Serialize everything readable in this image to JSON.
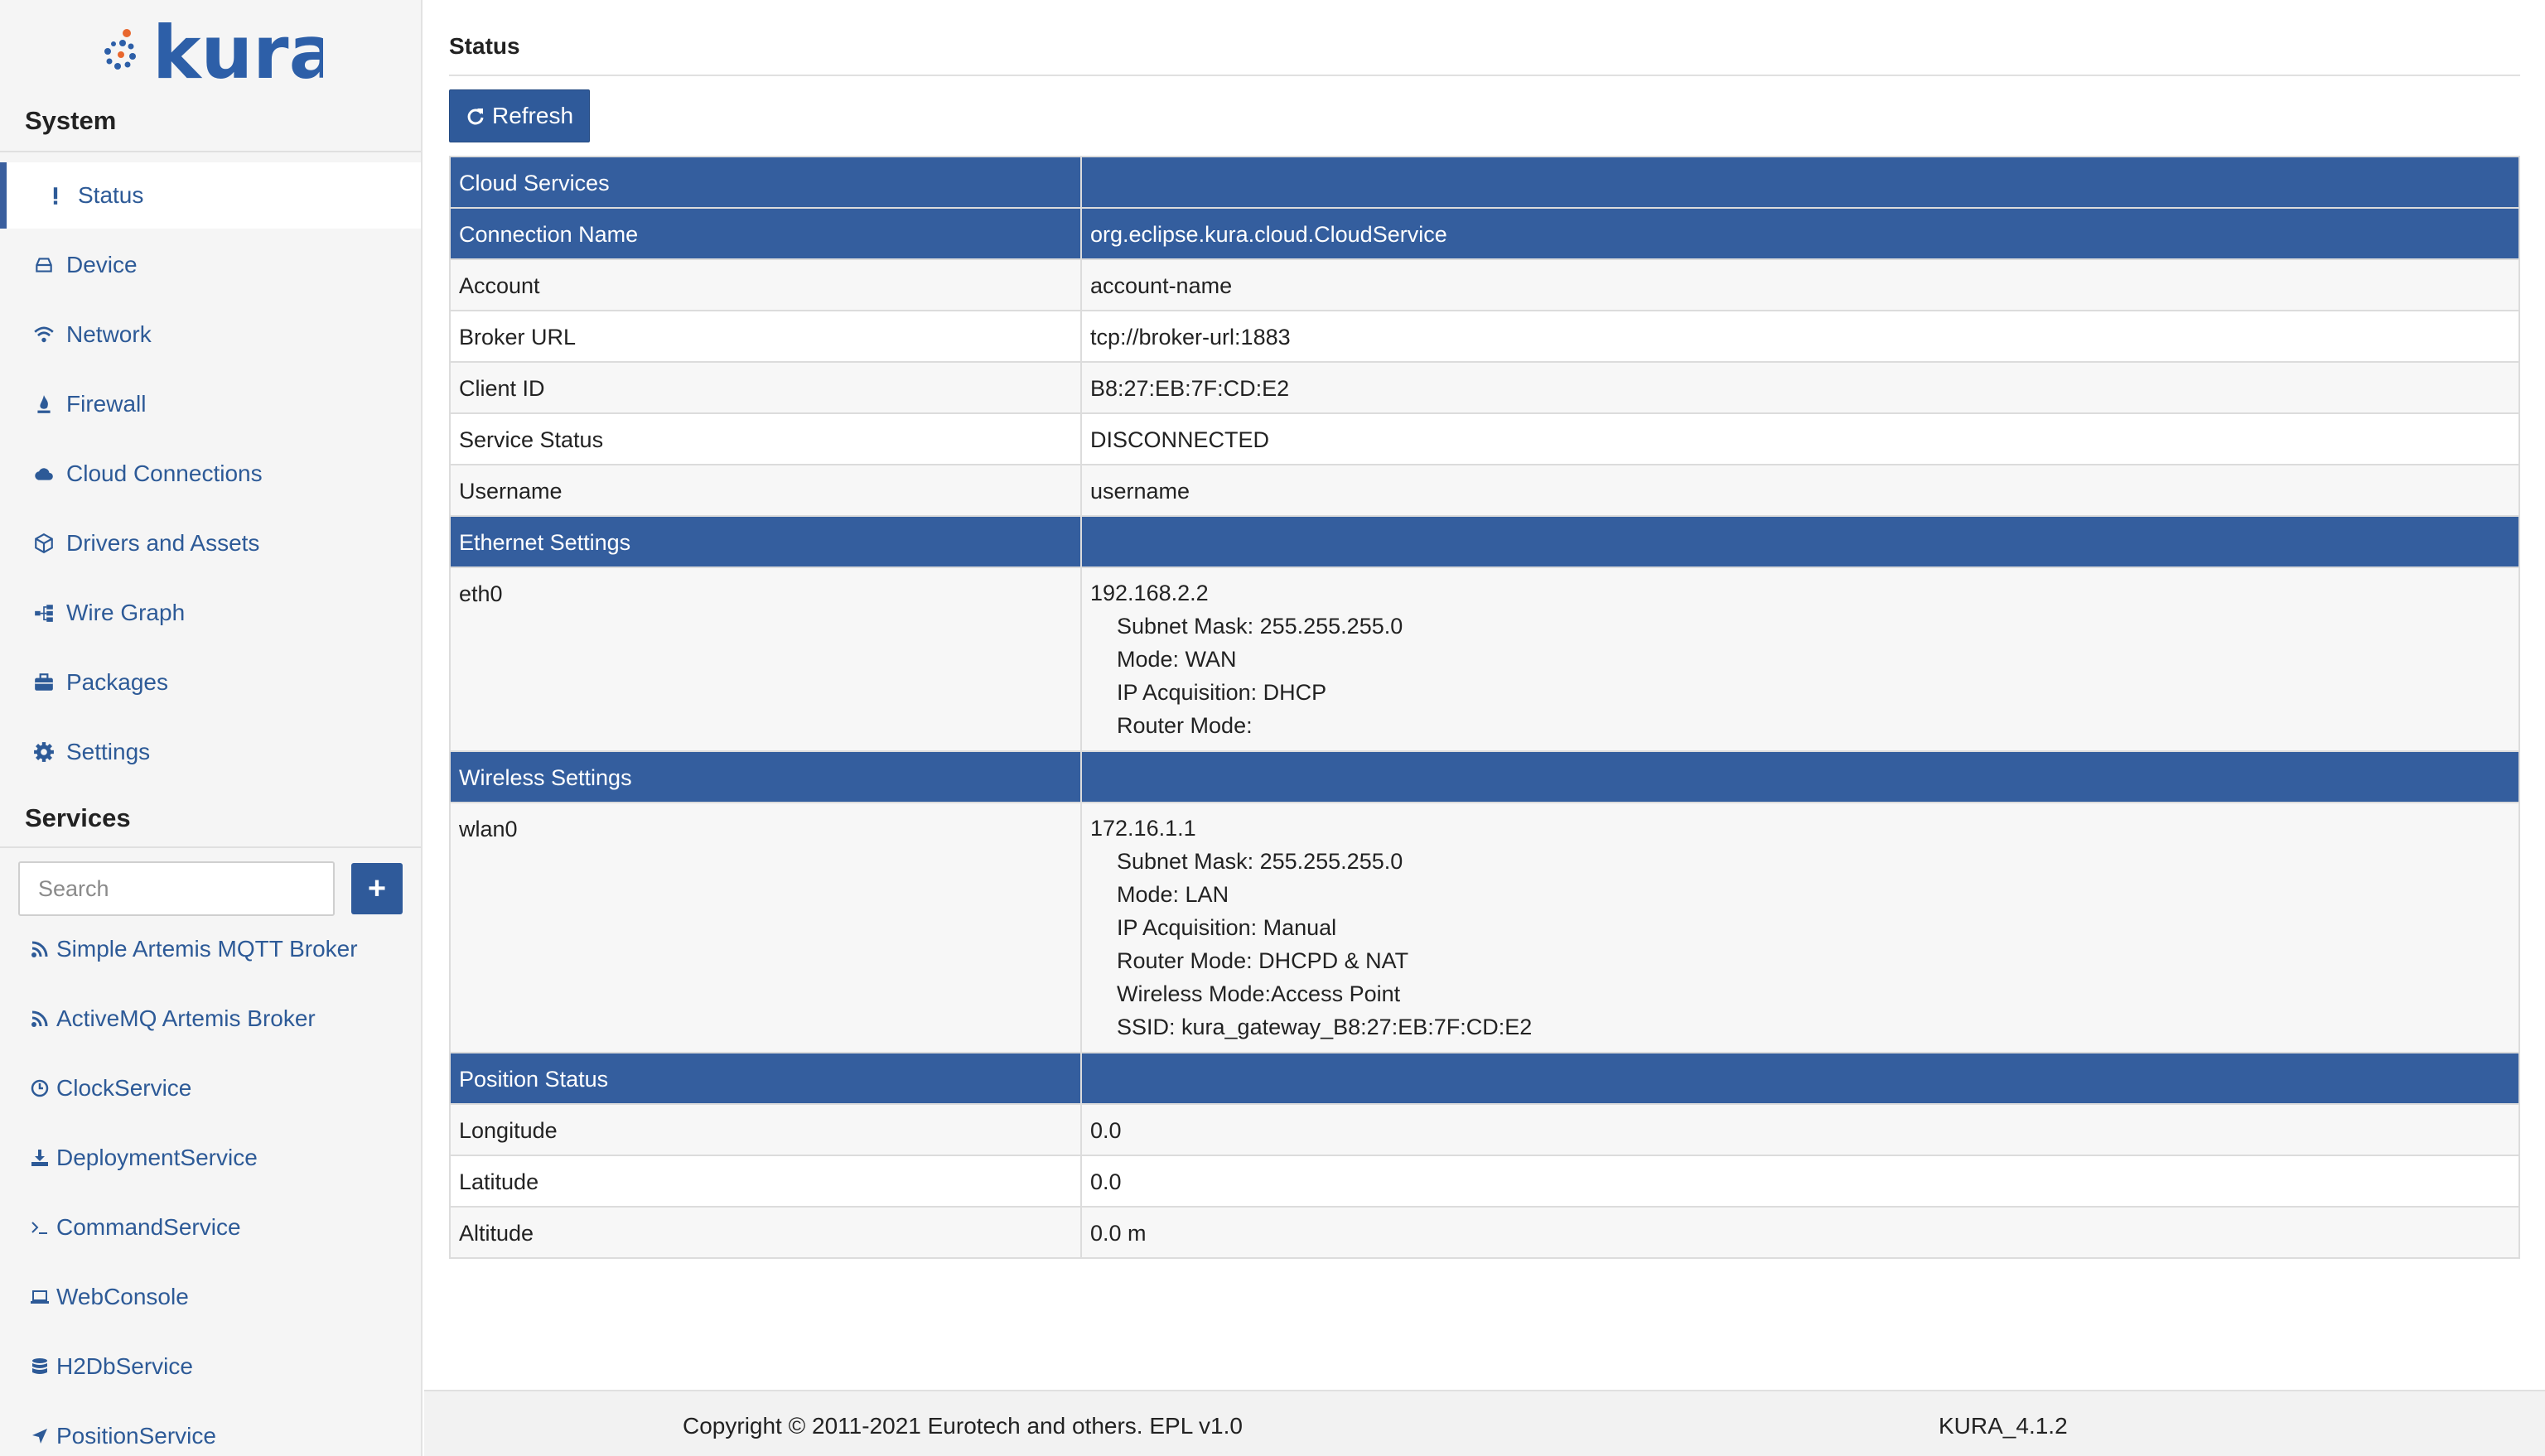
{
  "brand": {
    "logo_text": "kura",
    "accent_color": "#2f5a9a",
    "logo_blue": "#2d5fa8",
    "logo_orange": "#e8672e"
  },
  "sidebar": {
    "system_title": "System",
    "items": [
      {
        "label": "Status",
        "icon": "exclamation-icon",
        "active": true
      },
      {
        "label": "Device",
        "icon": "hdd-icon"
      },
      {
        "label": "Network",
        "icon": "wifi-icon"
      },
      {
        "label": "Firewall",
        "icon": "fire-icon"
      },
      {
        "label": "Cloud Connections",
        "icon": "cloud-icon"
      },
      {
        "label": "Drivers and Assets",
        "icon": "cube-icon"
      },
      {
        "label": "Wire Graph",
        "icon": "sitemap-icon"
      },
      {
        "label": "Packages",
        "icon": "briefcase-icon"
      },
      {
        "label": "Settings",
        "icon": "gear-icon"
      }
    ],
    "services_title": "Services",
    "search": {
      "placeholder": "Search",
      "value": ""
    },
    "add_label": "+",
    "services": [
      {
        "label": "Simple Artemis MQTT Broker",
        "icon": "rss-icon"
      },
      {
        "label": "ActiveMQ Artemis Broker",
        "icon": "rss-icon"
      },
      {
        "label": "ClockService",
        "icon": "clock-icon"
      },
      {
        "label": "DeploymentService",
        "icon": "download-icon"
      },
      {
        "label": "CommandService",
        "icon": "terminal-icon"
      },
      {
        "label": "WebConsole",
        "icon": "laptop-icon"
      },
      {
        "label": "H2DbService",
        "icon": "database-icon"
      },
      {
        "label": "PositionService",
        "icon": "location-arrow-icon"
      }
    ]
  },
  "main": {
    "title": "Status",
    "refresh_label": "Refresh",
    "table": {
      "cloud_header": "Cloud Services",
      "connection_name_label": "Connection Name",
      "connection_name_value": "org.eclipse.kura.cloud.CloudService",
      "cloud_rows": [
        {
          "label": "Account",
          "value": "account-name"
        },
        {
          "label": "Broker URL",
          "value": "tcp://broker-url:1883"
        },
        {
          "label": "Client ID",
          "value": "B8:27:EB:7F:CD:E2"
        },
        {
          "label": "Service Status",
          "value": "DISCONNECTED"
        },
        {
          "label": "Username",
          "value": "username"
        }
      ],
      "ethernet_header": "Ethernet Settings",
      "ethernet": {
        "iface": "eth0",
        "ip": "192.168.2.2",
        "details": [
          "Subnet Mask: 255.255.255.0",
          "Mode: WAN",
          "IP Acquisition: DHCP",
          "Router Mode:"
        ]
      },
      "wireless_header": "Wireless Settings",
      "wireless": {
        "iface": "wlan0",
        "ip": "172.16.1.1",
        "details": [
          "Subnet Mask: 255.255.255.0",
          "Mode: LAN",
          "IP Acquisition: Manual",
          "Router Mode: DHCPD & NAT",
          "Wireless Mode:Access Point",
          "SSID: kura_gateway_B8:27:EB:7F:CD:E2"
        ]
      },
      "position_header": "Position Status",
      "position_rows": [
        {
          "label": "Longitude",
          "value": "0.0"
        },
        {
          "label": "Latitude",
          "value": "0.0"
        },
        {
          "label": "Altitude",
          "value": "0.0 m"
        }
      ]
    }
  },
  "footer": {
    "copyright": "Copyright © 2011-2021 Eurotech and others. EPL v1.0",
    "version": "KURA_4.1.2"
  }
}
